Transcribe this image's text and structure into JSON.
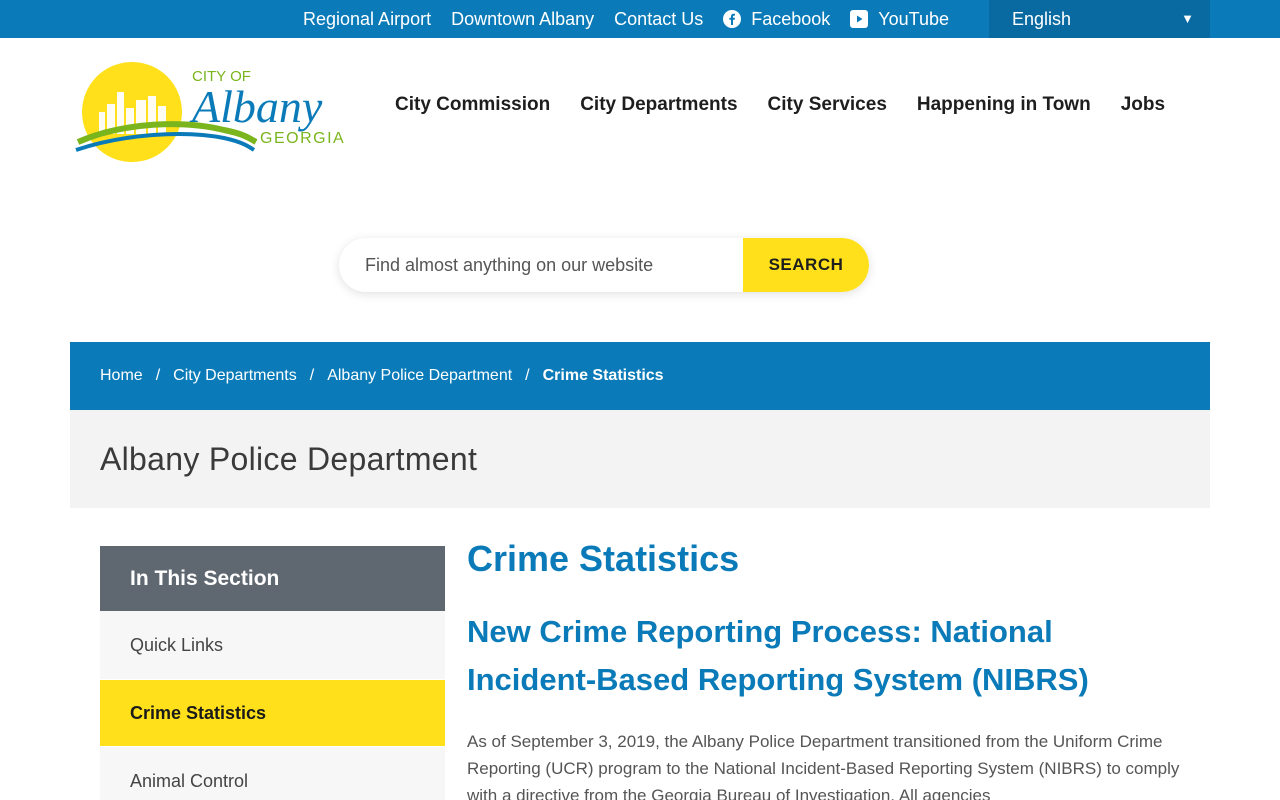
{
  "topbar": {
    "links": [
      {
        "label": "Regional Airport"
      },
      {
        "label": "Downtown Albany"
      },
      {
        "label": "Contact Us"
      },
      {
        "label": "Facebook",
        "icon": "facebook-icon"
      },
      {
        "label": "YouTube",
        "icon": "youtube-icon"
      }
    ],
    "language": {
      "selected": "English",
      "icon": "chevron-down-icon"
    }
  },
  "logo": {
    "city_of": "CITY OF",
    "name": "Albany",
    "state": "GEORGIA"
  },
  "nav": {
    "items": [
      {
        "label": "City Commission"
      },
      {
        "label": "City Departments"
      },
      {
        "label": "City Services"
      },
      {
        "label": "Happening in Town"
      },
      {
        "label": "Jobs"
      }
    ]
  },
  "search": {
    "placeholder": "Find almost anything on our website",
    "value": "",
    "button_label": "SEARCH"
  },
  "breadcrumb": {
    "items": [
      "Home",
      "City Departments",
      "Albany Police Department"
    ],
    "separator": "/",
    "current": "Crime Statistics"
  },
  "page": {
    "section_title": "Albany Police Department"
  },
  "sidebar": {
    "heading": "In This Section",
    "items": [
      {
        "label": "Quick Links",
        "active": false
      },
      {
        "label": "Crime Statistics",
        "active": true
      },
      {
        "label": "Animal Control",
        "active": false
      }
    ]
  },
  "content": {
    "title": "Crime Statistics",
    "subtitle": "New Crime Reporting Process: National Incident-Based Reporting System (NIBRS)",
    "paragraph": "As of September 3, 2019, the Albany Police Department transitioned from the Uniform Crime Reporting (UCR) program to the National Incident-Based Reporting System (NIBRS) to comply with a directive from the Georgia Bureau of Investigation. All agencies"
  },
  "colors": {
    "primary_blue": "#0a7bb8",
    "accent_yellow": "#ffe01b",
    "sidebar_heading": "#5f6770",
    "logo_green": "#7ab51d"
  }
}
